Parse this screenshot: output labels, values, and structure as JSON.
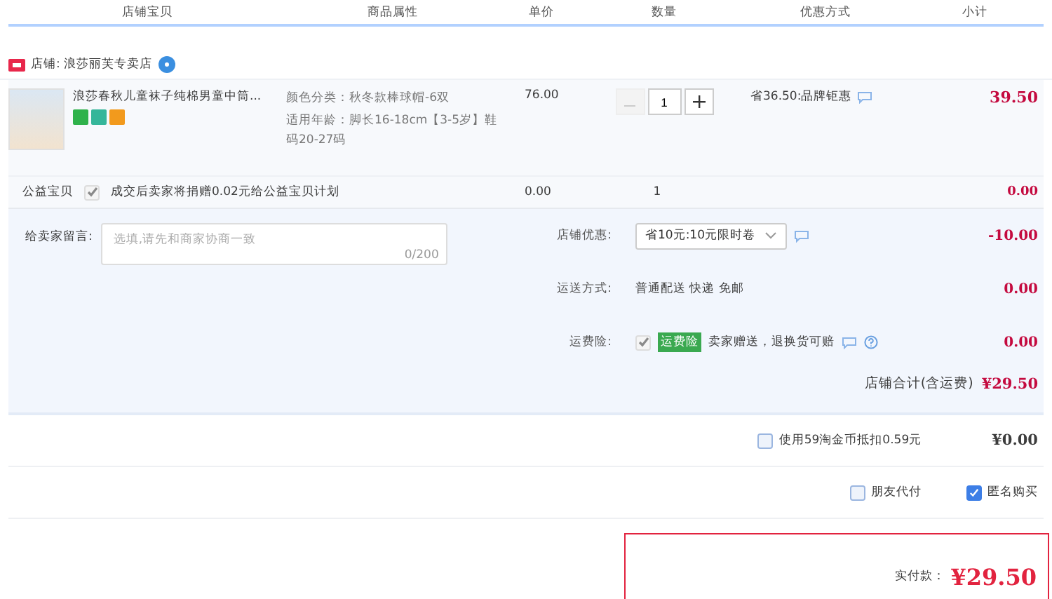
{
  "columns": [
    "店铺宝贝",
    "商品属性",
    "单价",
    "数量",
    "优惠方式",
    "小计"
  ],
  "store": {
    "label": "店铺: 浪莎丽芙专卖店"
  },
  "item": {
    "title": "浪莎春秋儿童袜子纯棉男童中筒...",
    "attributes": [
      "颜色分类：秋冬款棒球帽-6双",
      "适用年龄：脚长16-18cm【3-5岁】鞋码20-27码"
    ],
    "price": "76.00",
    "quantity": "1",
    "decrease_disabled": true,
    "discount": "省36.50:品牌钜惠",
    "subtotal": "39.50"
  },
  "charity": {
    "label": "公益宝贝",
    "checked": true,
    "text": "成交后卖家将捐赠0.02元给公益宝贝计划",
    "price": "0.00",
    "quantity": "1",
    "subtotal": "0.00"
  },
  "message": {
    "label": "给卖家留言:",
    "placeholder": "选填,请先和商家协商一致",
    "counter": "0/200"
  },
  "order_rows": [
    {
      "kind": "select",
      "label": "店铺优惠:",
      "value": "省10元:10元限时卷",
      "amount": "-10.00"
    },
    {
      "kind": "text",
      "label": "运送方式:",
      "value": "普通配送 快递 免邮",
      "amount": "0.00"
    },
    {
      "kind": "insurance",
      "label": "运费险:",
      "checked": true,
      "tag": "运费险",
      "value": "卖家赠送，退换货可赔",
      "amount": "0.00"
    }
  ],
  "store_total": {
    "label": "店铺合计(含运费)",
    "amount": "¥29.50"
  },
  "coins": {
    "checked": false,
    "label": "使用59淘金币抵扣0.59元",
    "amount": "¥0.00"
  },
  "options": [
    {
      "label": "朋友代付",
      "checked": false
    },
    {
      "label": "匿名购买",
      "checked": true
    }
  ],
  "pay": {
    "label": "实付款：",
    "amount": "¥29.50"
  }
}
